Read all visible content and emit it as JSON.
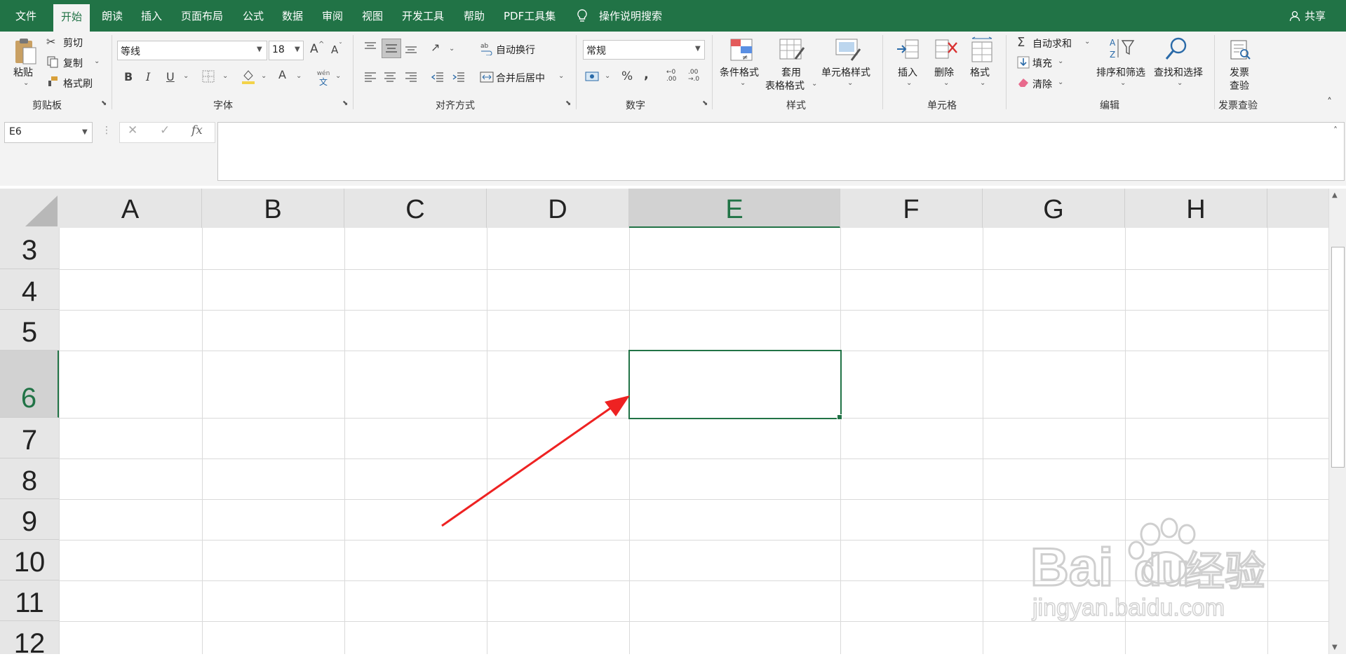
{
  "tabs": [
    "文件",
    "开始",
    "朗读",
    "插入",
    "页面布局",
    "公式",
    "数据",
    "审阅",
    "视图",
    "开发工具",
    "帮助",
    "PDF工具集",
    "操作说明搜索"
  ],
  "share": "共享",
  "clipboard": {
    "paste": "粘贴",
    "cut": "剪切",
    "copy": "复制",
    "format_painter": "格式刷",
    "group": "剪贴板"
  },
  "font": {
    "name": "等线",
    "size": "18",
    "bold": "B",
    "italic": "I",
    "underline": "U",
    "color_a": "A",
    "phonetic_top": "wén",
    "phonetic_bottom": "文",
    "grow": "A",
    "shrink": "A",
    "group": "字体"
  },
  "alignment": {
    "wrap": "自动换行",
    "merge": "合并后居中",
    "group": "对齐方式"
  },
  "number": {
    "format": "常规",
    "percent": "%",
    "comma": ",",
    "inc_decimal_top": "←0",
    "inc_decimal_bottom": ".00",
    "dec_decimal_top": ".00",
    "dec_decimal_bottom": "→.0",
    "group": "数字"
  },
  "styles": {
    "conditional": "条件格式",
    "table_line1": "套用",
    "table_line2": "表格格式",
    "cell": "单元格样式",
    "group": "样式"
  },
  "cells": {
    "insert": "插入",
    "delete": "删除",
    "format": "格式",
    "group": "单元格"
  },
  "editing": {
    "autosum": "自动求和",
    "fill": "填充",
    "clear": "清除",
    "sort": "排序和筛选",
    "find": "查找和选择",
    "group": "编辑"
  },
  "invoice": {
    "line1": "发票",
    "line2": "查验",
    "group": "发票查验"
  },
  "formula_bar": {
    "name_box": "E6",
    "fx": "fx",
    "content": ""
  },
  "columns": [
    "A",
    "B",
    "C",
    "D",
    "E",
    "F",
    "G",
    "H"
  ],
  "rows": [
    "3",
    "4",
    "5",
    "6",
    "7",
    "8",
    "9",
    "10",
    "11",
    "12"
  ],
  "selected_cell": {
    "column": "E",
    "row": "6"
  },
  "watermark": {
    "brand": "Bai",
    "brand2": "du",
    "cn": "经验",
    "url": "jingyan.baidu.com"
  },
  "colors": {
    "accent": "#217346",
    "selection": "#217346",
    "annotation_arrow": "#ee2222"
  }
}
